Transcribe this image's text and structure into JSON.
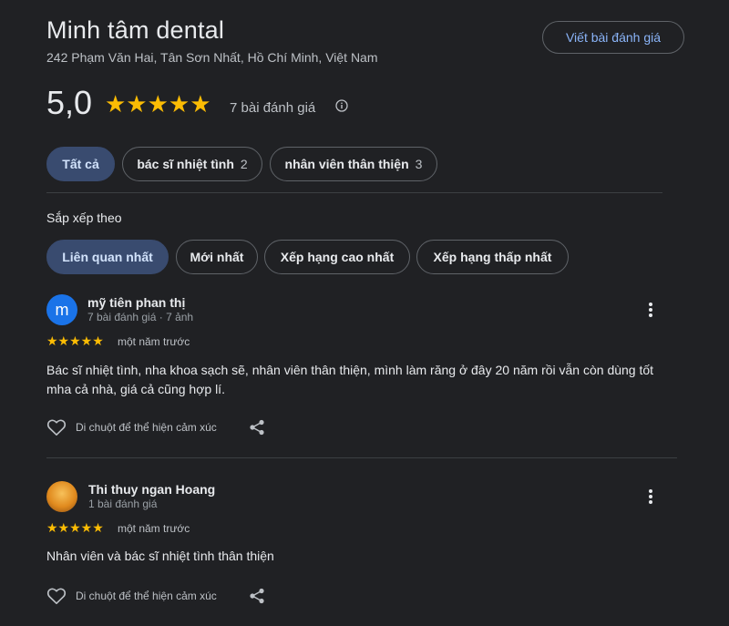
{
  "place": {
    "name": "Minh tâm dental",
    "address": "242 Phạm Văn Hai, Tân Sơn Nhất, Hồ Chí Minh, Việt Nam",
    "write_review_label": "Viết bài đánh giá"
  },
  "summary": {
    "rating": "5,0",
    "stars": "★★★★★",
    "rating_value": 5,
    "review_count": "7 bài đánh giá",
    "info_icon": "info-icon"
  },
  "topics": [
    {
      "label": "Tất cả",
      "count": "",
      "active": true
    },
    {
      "label": "bác sĩ nhiệt tình",
      "count": "2",
      "active": false
    },
    {
      "label": "nhân viên thân thiện",
      "count": "3",
      "active": false
    }
  ],
  "sort": {
    "label": "Sắp xếp theo",
    "options": [
      {
        "label": "Liên quan nhất",
        "active": true
      },
      {
        "label": "Mới nhất",
        "active": false
      },
      {
        "label": "Xếp hạng cao nhất",
        "active": false
      },
      {
        "label": "Xếp hạng thấp nhất",
        "active": false
      }
    ]
  },
  "reviews": [
    {
      "avatar_letter": "m",
      "avatar_color": "#1a73e8",
      "name": "mỹ tiên phan thị",
      "meta": "7 bài đánh giá · 7 ảnh",
      "stars": "★★★★★",
      "rating_value": 5,
      "time": "một năm trước",
      "text": "Bác sĩ nhiệt tình, nha khoa sạch sẽ, nhân viên thân thiện, mình làm răng ở đây 20 năm rồi vẫn còn dùng tốt mha cả nhà, giá cả cũng hợp lí.",
      "react_label": "Di chuột để thể hiện cảm xúc"
    },
    {
      "avatar_letter": "",
      "avatar_color": "#e08a1e",
      "name": "Thi thuy ngan Hoang",
      "meta": "1 bài đánh giá",
      "stars": "★★★★★",
      "rating_value": 5,
      "time": "một năm trước",
      "text": "Nhân viên và bác sĩ nhiệt tình thân thiện",
      "react_label": "Di chuột để thể hiện cảm xúc"
    }
  ],
  "colors": {
    "background": "#202124",
    "accent": "#8ab4f8",
    "star": "#fbbc04",
    "active_chip": "#394b6f"
  }
}
